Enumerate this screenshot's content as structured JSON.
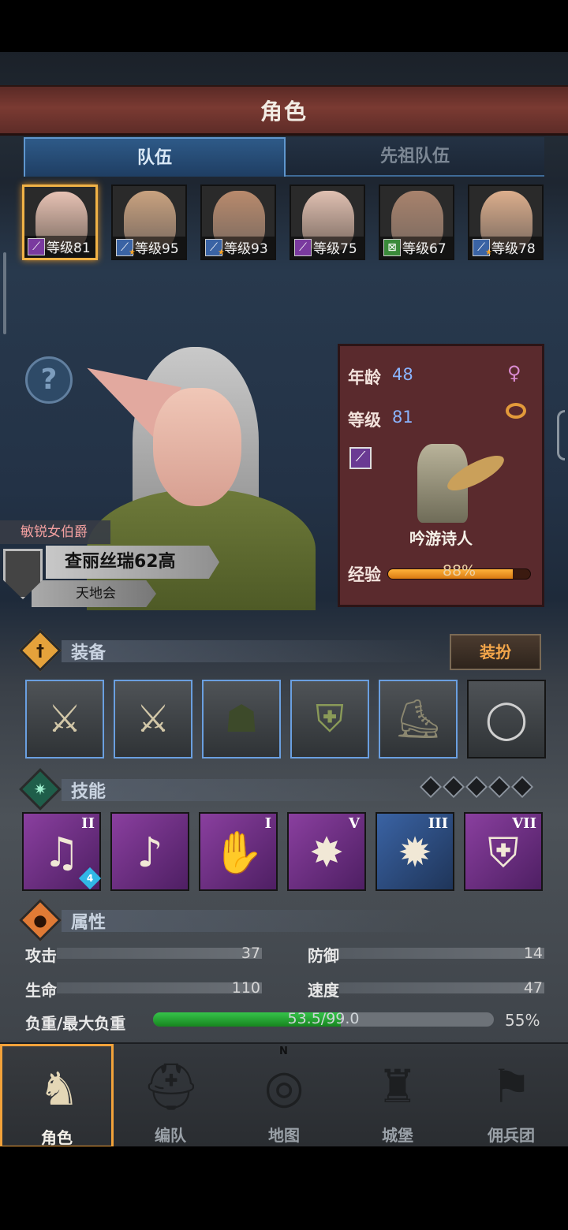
{
  "header": {
    "title": "角色"
  },
  "tabs": {
    "team": "队伍",
    "ancestor_team": "先祖队伍"
  },
  "roster": [
    {
      "level": "等级81",
      "class_color": "#7a3a9f",
      "class_icon": "staff-icon",
      "face_color": "#e7c2b4"
    },
    {
      "level": "等级95",
      "class_color": "#3a63a4",
      "class_icon": "sword-icon",
      "face_color": "#c9a27f"
    },
    {
      "level": "等级93",
      "class_color": "#3a63a4",
      "class_icon": "sword-icon",
      "face_color": "#b98a6c"
    },
    {
      "level": "等级75",
      "class_color": "#7a3a9f",
      "class_icon": "staff-icon",
      "face_color": "#e0c0b2"
    },
    {
      "level": "等级67",
      "class_color": "#3a8a3a",
      "class_icon": "bow-icon",
      "face_color": "#a8826c"
    },
    {
      "level": "等级78",
      "class_color": "#3a63a4",
      "class_icon": "sword-icon",
      "face_color": "#dcae8c"
    }
  ],
  "hero": {
    "title": "敏锐女伯爵",
    "name": "查丽丝瑞62高",
    "guild": "天地会",
    "age_label": "年龄",
    "age": "48",
    "level_label": "等级",
    "level": "81",
    "class_name": "吟游诗人",
    "xp_label": "经验",
    "xp_text": "88%",
    "xp_fraction": 0.88
  },
  "equipment": {
    "title": "装备",
    "costume_button": "装扮",
    "slots": [
      {
        "name": "equip-weapon-main",
        "glyph": "⚔",
        "bordered": true
      },
      {
        "name": "equip-weapon-off",
        "glyph": "⚔",
        "bordered": true
      },
      {
        "name": "equip-hood",
        "glyph": "☗",
        "bordered": true
      },
      {
        "name": "equip-armor",
        "glyph": "⛨",
        "bordered": true
      },
      {
        "name": "equip-boots",
        "glyph": "⛸",
        "bordered": true
      },
      {
        "name": "equip-ring",
        "glyph": "◯",
        "bordered": false
      }
    ]
  },
  "skills": {
    "title": "技能",
    "list": [
      {
        "rank": "II",
        "glyph": "♫",
        "color": "purple",
        "badge": "4"
      },
      {
        "rank": "",
        "glyph": "♪",
        "color": "purple",
        "badge": ""
      },
      {
        "rank": "I",
        "glyph": "✋",
        "color": "purple",
        "badge": ""
      },
      {
        "rank": "V",
        "glyph": "✸",
        "color": "purple",
        "badge": ""
      },
      {
        "rank": "III",
        "glyph": "✹",
        "color": "blue",
        "badge": ""
      },
      {
        "rank": "VII",
        "glyph": "⛨",
        "color": "purple",
        "badge": ""
      }
    ]
  },
  "attributes": {
    "title": "属性",
    "attack_label": "攻击",
    "attack": "37",
    "defense_label": "防御",
    "defense": "14",
    "hp_label": "生命",
    "hp": "110",
    "speed_label": "速度",
    "speed": "47",
    "load_label": "负重/最大负重",
    "load_text": "53.5/99.0",
    "load_pct": "55%",
    "load_fraction": 0.55
  },
  "nav": {
    "character": "角色",
    "formation": "编队",
    "map": "地图",
    "castle": "城堡",
    "mercenary": "佣兵团",
    "compass_letter": "N"
  }
}
